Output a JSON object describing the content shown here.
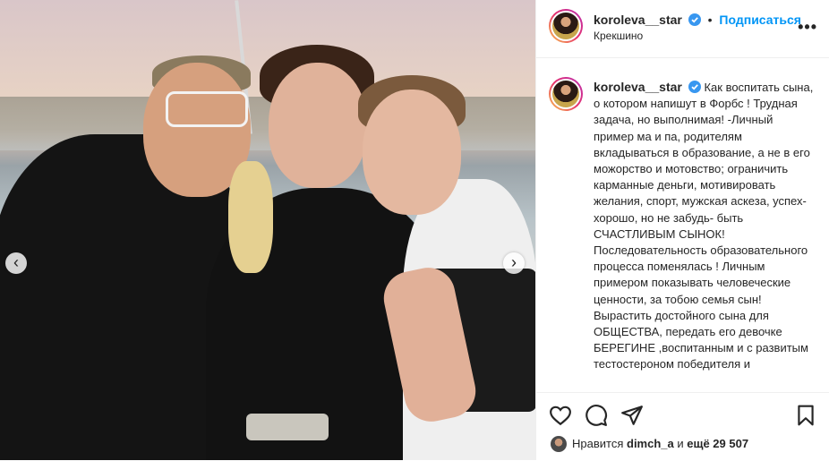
{
  "post": {
    "author": "koroleva__star",
    "follow_label": "Подписаться",
    "separator": "•",
    "location": "Крекшино",
    "more_label": "•••"
  },
  "caption": {
    "author": "koroleva__star",
    "text": "Как воспитать сына, о котором напишут в Форбс ! Трудная задача, но выполнимая! -Личный пример ма и па, родителям вкладываться в образование, а не в его можорство и мотовство; ограничить карманные деньги, мотивировать желания, спорт, мужская аскеза, успех- хорошо, но не забудь- быть СЧАСТЛИВЫМ СЫНОК! Последовательность образовательного процесса поменялась ! Личным примером показывать человеческие ценности, за тобою семья сын! Вырастить достойного сына для ОБЩЕСТВА, передать его девочке БЕРЕГИНЕ ,воспитанным и с развитым тестостероном победителя и"
  },
  "likes": {
    "prefix": "Нравится",
    "user": "dimch_a",
    "middle": "и",
    "count": "ещё 29 507"
  },
  "icons": {
    "carousel_prev": "chevron-left-icon",
    "carousel_next": "chevron-right-icon",
    "verified": "verified-badge-icon",
    "like": "heart-icon",
    "comment": "comment-icon",
    "share": "send-icon",
    "save": "bookmark-icon"
  },
  "colors": {
    "accent": "#0095f6",
    "verified": "#3897f0",
    "text": "#262626"
  }
}
